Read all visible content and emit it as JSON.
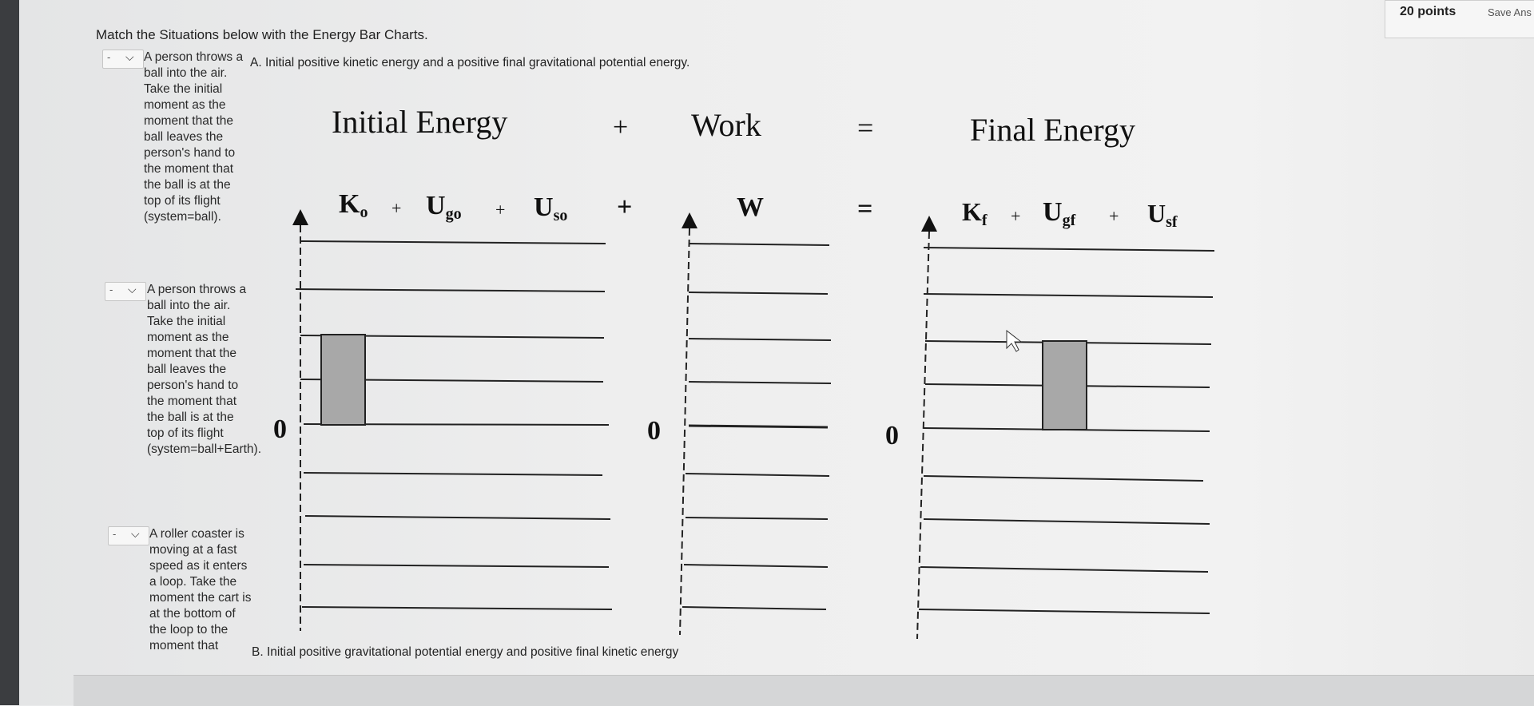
{
  "header": {
    "points": "20 points",
    "save_label": "Save Ans"
  },
  "question": {
    "prompt": "Match the Situations below with the Energy Bar Charts."
  },
  "situations": [
    {
      "dash": "-",
      "text": "A person throws a ball into the air. Take the initial moment as the moment that the ball leaves the person's hand to the moment that the ball is at the top of its flight (system=ball)."
    },
    {
      "dash": "-",
      "text": "A person throws a ball into the air. Take the initial moment as the moment that the ball leaves the person's hand to the moment that the ball is at the top of its flight (system=ball+Earth)."
    },
    {
      "dash": "-",
      "text": "A roller coaster is moving at a fast speed as it enters a loop. Take the moment the cart is at the bottom of the loop to the moment that"
    }
  ],
  "choices": {
    "a": "A. Initial positive kinetic energy and a positive final gravitational potential energy.",
    "b": "B. Initial positive gravitational potential energy and positive final kinetic energy"
  },
  "chart": {
    "headings": {
      "initial": "Initial Energy",
      "plus": "+",
      "work": "Work",
      "equals": "=",
      "final": "Final Energy"
    },
    "zero_label": "0",
    "initial_terms": [
      "K",
      "U",
      "U"
    ],
    "initial_subs": [
      "o",
      "go",
      "so"
    ],
    "work_term": "W",
    "final_terms": [
      "K",
      "U",
      "U"
    ],
    "final_subs": [
      "f",
      "gf",
      "sf"
    ],
    "bars": {
      "initial_K_units": 2,
      "final_Ugf_units": 2
    }
  }
}
